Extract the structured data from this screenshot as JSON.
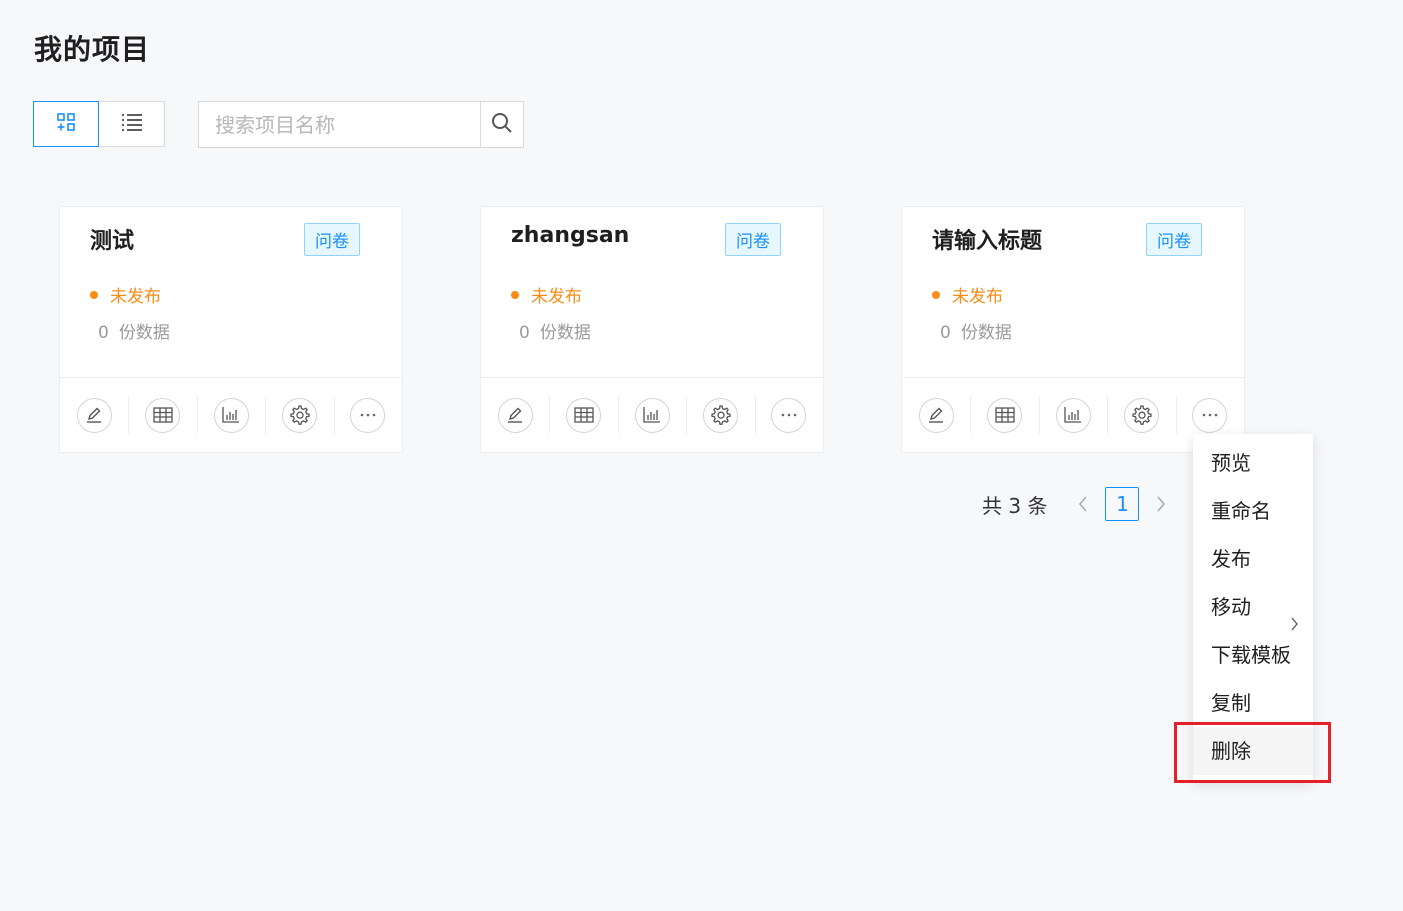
{
  "page": {
    "title": "我的项目"
  },
  "toolbar": {
    "views": [
      {
        "icon": "grid-view-icon",
        "active": true
      },
      {
        "icon": "list-view-icon",
        "active": false
      }
    ],
    "search": {
      "placeholder": "搜索项目名称",
      "value": "",
      "icon": "search-icon"
    }
  },
  "projects": [
    {
      "title": "测试",
      "tag": "问卷",
      "status": "未发布",
      "count": "0",
      "count_label": "份数据"
    },
    {
      "title": "zhangsan",
      "tag": "问卷",
      "status": "未发布",
      "count": "0",
      "count_label": "份数据"
    },
    {
      "title": "请输入标题",
      "tag": "问卷",
      "status": "未发布",
      "count": "0",
      "count_label": "份数据"
    }
  ],
  "card_actions": [
    "edit-icon",
    "table-icon",
    "chart-icon",
    "settings-icon",
    "more-icon"
  ],
  "pagination": {
    "total_text": "共 3 条",
    "current_page": "1"
  },
  "context_menu": {
    "items": [
      {
        "label": "预览"
      },
      {
        "label": "重命名"
      },
      {
        "label": "发布"
      },
      {
        "label": "移动",
        "has_submenu": true
      },
      {
        "label": "下载模板"
      },
      {
        "label": "复制"
      },
      {
        "label": "删除",
        "highlighted": true
      }
    ]
  },
  "colors": {
    "accent": "#1890ff",
    "status_unpublished": "#fa8c16",
    "highlight_border": "#e6202a",
    "background": "#f7f8fa"
  }
}
